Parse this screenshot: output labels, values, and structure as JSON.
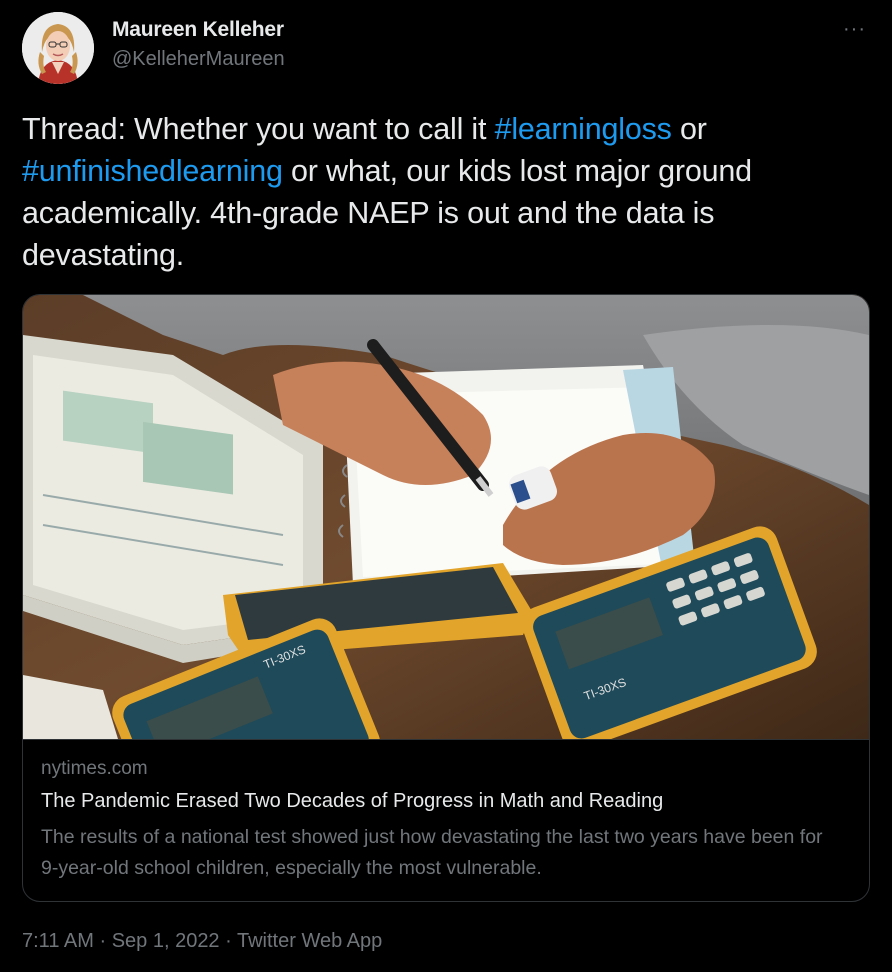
{
  "author": {
    "display_name": "Maureen Kelleher",
    "handle": "@KelleherMaureen"
  },
  "menu": {
    "more_label": "···"
  },
  "tweet": {
    "text_before": "Thread: Whether you want to call it  ",
    "hashtag1": "#learningloss",
    "text_middle1": " or ",
    "hashtag2": "#unfinishedlearning",
    "text_after": " or what, our kids lost major ground academically. 4th-grade NAEP is out and the data is devastating."
  },
  "card": {
    "domain": "nytimes.com",
    "title": "The Pandemic Erased Two Decades of Progress in Math and Reading",
    "description": "The results of a national test showed just how devastating the last two years have been for 9-year-old school children, especially the most vulnerable.",
    "calculator_label": "TI-30XS"
  },
  "meta": {
    "time": "7:11 AM",
    "sep1": " · ",
    "date": "Sep 1, 2022",
    "sep2": " · ",
    "source": "Twitter Web App"
  },
  "colors": {
    "background": "#000000",
    "text": "#e7e9ea",
    "secondary": "#71767b",
    "hashtag": "#1d9bf0",
    "border": "#2f3336"
  }
}
